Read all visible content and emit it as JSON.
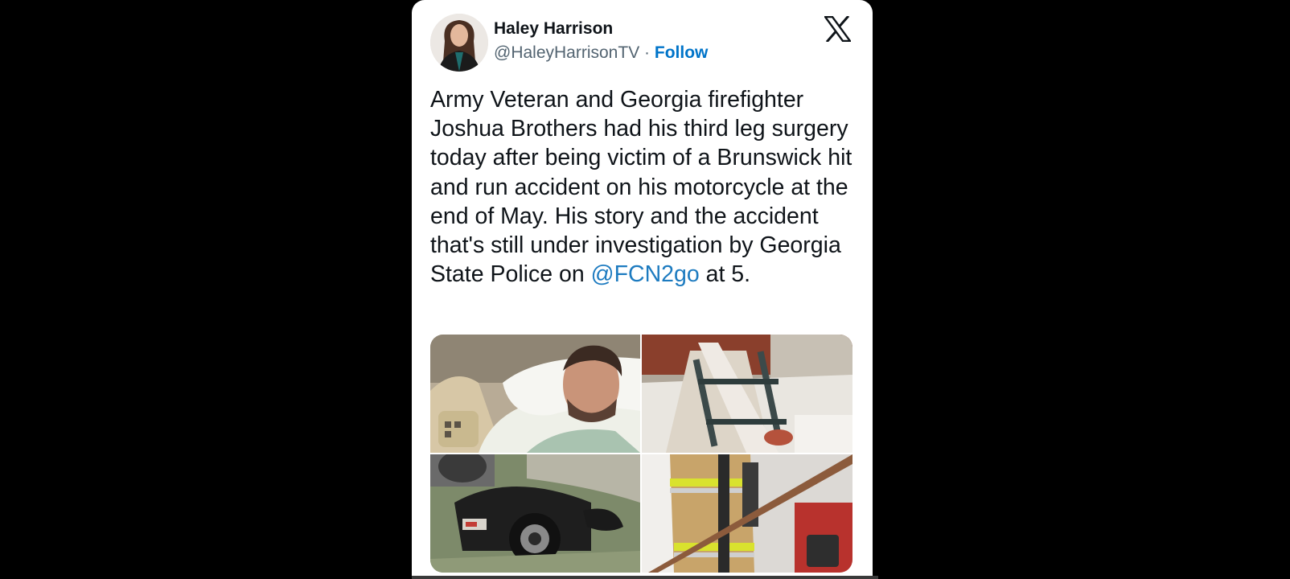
{
  "tweet": {
    "author": {
      "name": "Haley Harrison",
      "handle": "@HaleyHarrisonTV",
      "separator": "·",
      "follow_label": "Follow"
    },
    "brand_icon": "x-logo-icon",
    "text_before_mention": "Army Veteran and Georgia firefighter Joshua Brothers had his third leg surgery today after being victim of a Brunswick hit and run accident on his motorcycle at the end of May. His story and the accident that's still under investigation by Georgia State Police on ",
    "mention": "@FCN2go",
    "text_after_mention": " at 5.",
    "media_count": 4
  },
  "colors": {
    "background": "#000000",
    "card": "#ffffff",
    "text": "#0f1419",
    "secondary_text": "#536471",
    "link": "#1d7bc0"
  }
}
